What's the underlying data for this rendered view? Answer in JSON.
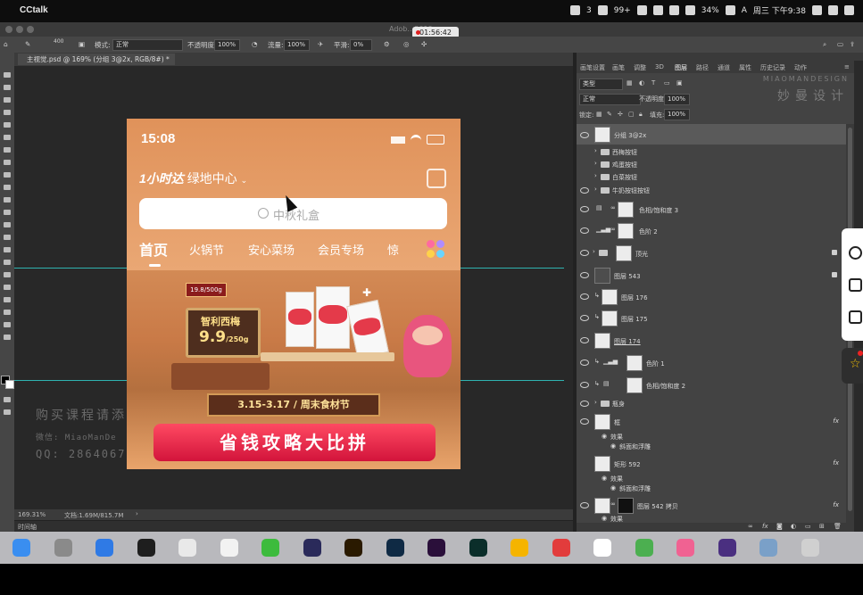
{
  "menubar": {
    "app_name": "CCtalk",
    "battery": "34%",
    "badge_count": "3",
    "badge_count2": "99+",
    "input_method": "A",
    "clock": "周三 下午9:38"
  },
  "recorder": {
    "elapsed": "01:56:42"
  },
  "window_ghost_title": "Adob…2019",
  "options_bar": {
    "mode_label": "模式:",
    "mode_value": "正常",
    "opacity_label": "不透明度:",
    "opacity_value": "100%",
    "flow_label": "流量:",
    "flow_value": "100%",
    "smooth_label": "平滑:",
    "smooth_value": "0%",
    "brush_size": "400"
  },
  "document_tab": {
    "title": "主视觉.psd @ 169% (分组 3@2x, RGB/8#) *"
  },
  "status_bar": {
    "zoom": "169.31%",
    "doc_size": "文档:1.69M/815.7M"
  },
  "timeline": {
    "label": "时间轴"
  },
  "mobile_design": {
    "time": "15:08",
    "location_prefix": "1小时达",
    "location": "绿地中心",
    "search_placeholder": "中秋礼盒",
    "nav": [
      "首页",
      "火锅节",
      "安心菜场",
      "会员专场",
      "惊"
    ],
    "price_tag": "19.8/500g",
    "product_name": "智利西梅",
    "price": "9.9",
    "price_unit": "/250g",
    "event_dates": "3.15-3.17 / 周末食材节",
    "headline": "省钱攻略大比拼"
  },
  "watermark": {
    "line1": "购买课程请添",
    "line2": "微信: MiaoManDe",
    "line3": "QQ: 2864067"
  },
  "panel_tabs": [
    "画笔设置",
    "画笔",
    "调整",
    "3D",
    "图层",
    "路径",
    "通道",
    "属性",
    "历史记录",
    "动作"
  ],
  "layers_panel": {
    "filter_kind": "类型",
    "blend_mode": "正常",
    "opacity_label": "不透明度:",
    "opacity_value": "100%",
    "lock_label": "锁定:",
    "fill_label": "填充:",
    "fill_value": "100%",
    "brand_en": "MIAOMANDESIGN",
    "brand_cn": "妙曼设计",
    "layers": [
      {
        "name": "分组 3@2x",
        "kind": "smart",
        "selected": true
      },
      {
        "name": "西梅按钮",
        "kind": "group"
      },
      {
        "name": "鸡蛋按钮",
        "kind": "group"
      },
      {
        "name": "白菜按钮",
        "kind": "group"
      },
      {
        "name": "牛奶按钮按钮",
        "kind": "group"
      },
      {
        "name": "色相/饱和度 3",
        "kind": "adjust"
      },
      {
        "name": "色阶 2",
        "kind": "adjust"
      },
      {
        "name": "顶光",
        "kind": "group-mask"
      },
      {
        "name": "图层 543",
        "kind": "dark"
      },
      {
        "name": "图层 176",
        "kind": "clip"
      },
      {
        "name": "图层 175",
        "kind": "clip"
      },
      {
        "name": "图层 174",
        "kind": "smart"
      },
      {
        "name": "色阶 1",
        "kind": "adjust-clip"
      },
      {
        "name": "色相/饱和度 2",
        "kind": "adjust-clip"
      },
      {
        "name": "瓶身",
        "kind": "group"
      },
      {
        "name": "框",
        "kind": "smart-fx"
      },
      {
        "name": "效果",
        "kind": "fx-label"
      },
      {
        "name": "斜面和浮雕",
        "kind": "fx-item"
      },
      {
        "name": "矩形 592",
        "kind": "smart-fx"
      },
      {
        "name": "效果",
        "kind": "fx-label"
      },
      {
        "name": "斜面和浮雕",
        "kind": "fx-item"
      },
      {
        "name": "图层 542 拷贝",
        "kind": "black-fx"
      },
      {
        "name": "效果",
        "kind": "fx-label"
      }
    ],
    "fx_symbol": "fx"
  },
  "dock_apps": [
    "Finder",
    "Launchpad",
    "Safari",
    "QQ",
    "Chrome",
    "Photos",
    "WeChat",
    "After Effects",
    "Illustrator",
    "Photoshop",
    "Premiere",
    "Audition",
    "Sketch",
    "NetEase Music",
    "Notion",
    "Numbers",
    "iTunes",
    "Premiere Pro",
    "Preview",
    "Trash"
  ],
  "colors": {
    "accent_teal_guide": "#2fb3b0",
    "selection_red": "#e02020"
  }
}
